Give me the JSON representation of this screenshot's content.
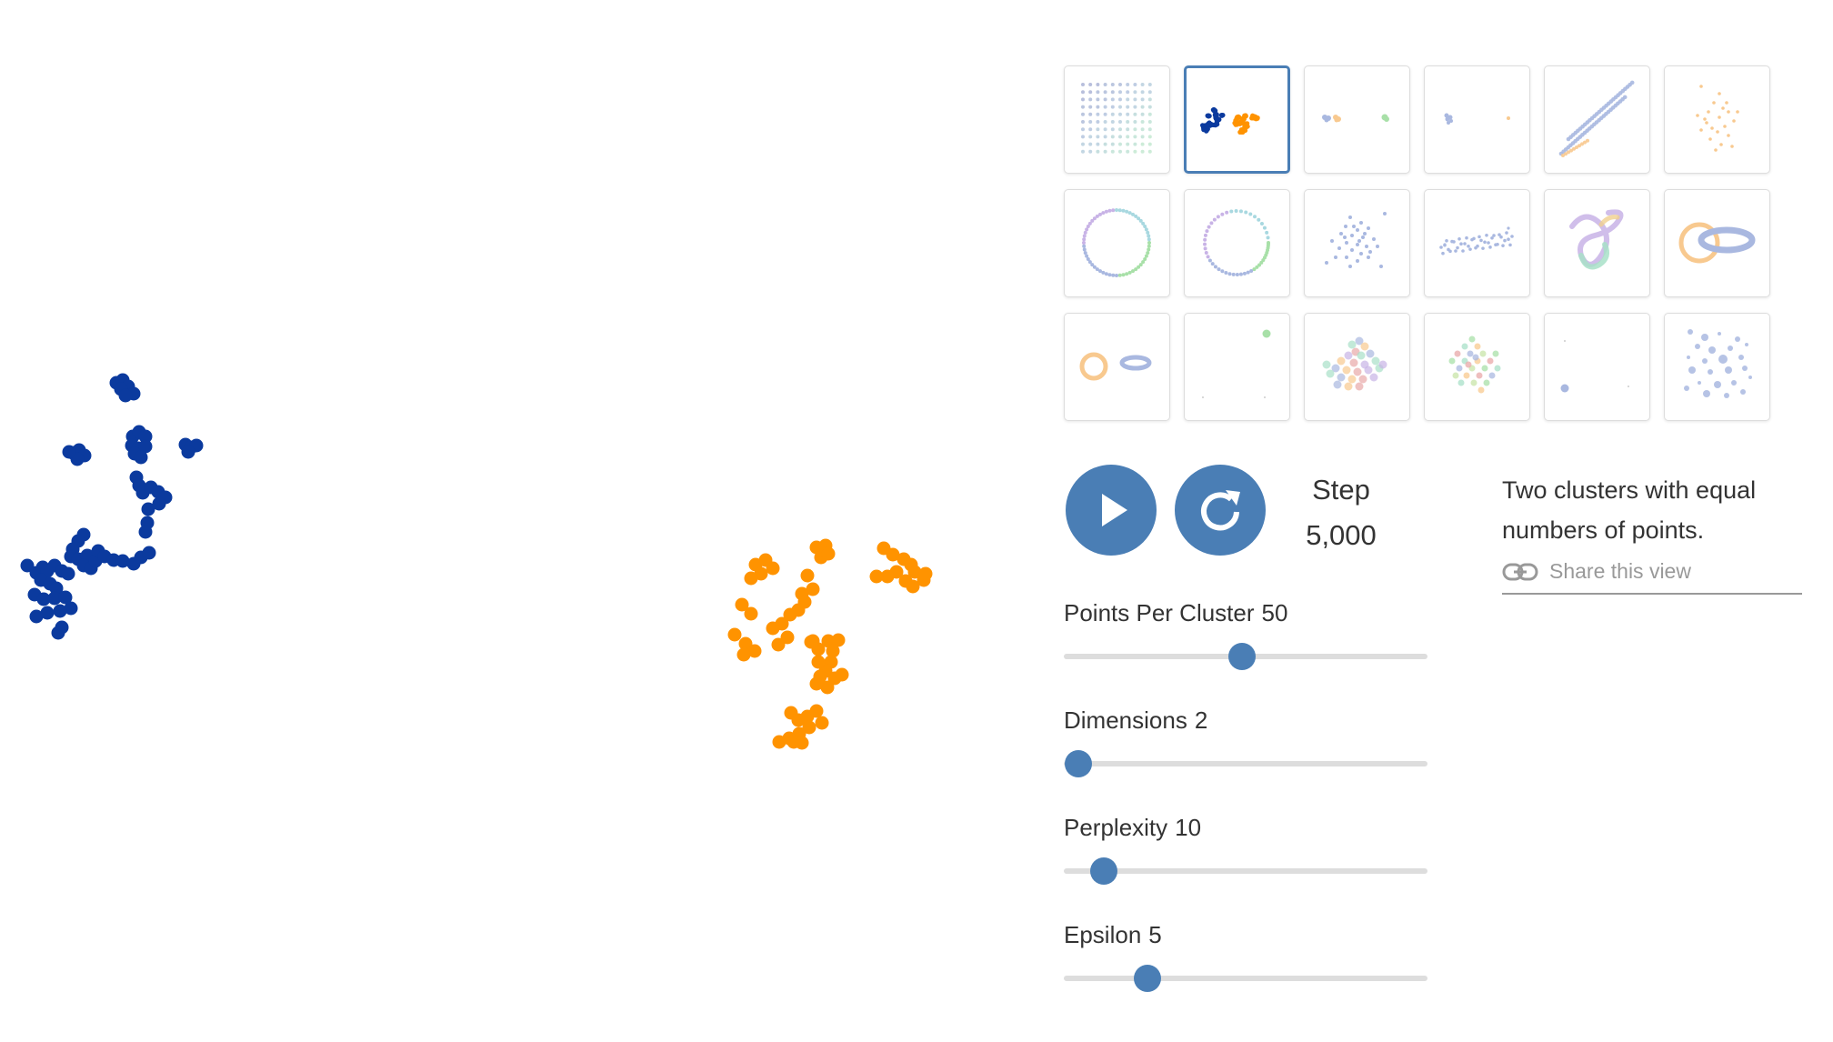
{
  "colors": {
    "accent": "#4a7eb5",
    "cluster_a": "#0b3a9e",
    "cluster_b": "#ff9300",
    "track": "#dddddd",
    "text": "#333333",
    "muted": "#999999"
  },
  "gallery": {
    "selected_index": 1,
    "items": [
      {
        "icon": "grid-dataset-icon"
      },
      {
        "icon": "two-clusters-icon"
      },
      {
        "icon": "three-clusters-icon"
      },
      {
        "icon": "two-distant-clusters-icon"
      },
      {
        "icon": "parallel-lines-icon"
      },
      {
        "icon": "random-walk-icon"
      },
      {
        "icon": "circle-icon"
      },
      {
        "icon": "unevenly-spaced-circle-icon"
      },
      {
        "icon": "gaussian-cloud-icon"
      },
      {
        "icon": "elongated-gaussian-icon"
      },
      {
        "icon": "trefoil-knot-icon"
      },
      {
        "icon": "linked-rings-icon"
      },
      {
        "icon": "unlinked-rings-icon"
      },
      {
        "icon": "sparse-points-icon"
      },
      {
        "icon": "random-jump-icon"
      },
      {
        "icon": "cube-icon"
      },
      {
        "icon": "subset-clusters-icon"
      },
      {
        "icon": "scattered-dots-icon"
      }
    ]
  },
  "controls": {
    "play_icon": "play-icon",
    "restart_icon": "restart-icon",
    "step_label": "Step",
    "step_value": "5,000"
  },
  "description": {
    "text": "Two clusters with equal numbers of points.",
    "share_label": "Share this view",
    "share_icon": "link-icon"
  },
  "sliders": [
    {
      "label": "Points Per Cluster",
      "value": "50",
      "position": 0.49
    },
    {
      "label": "Dimensions",
      "value": "2",
      "position": 0.04
    },
    {
      "label": "Perplexity",
      "value": "10",
      "position": 0.11
    },
    {
      "label": "Epsilon",
      "value": "5",
      "position": 0.23
    }
  ]
}
